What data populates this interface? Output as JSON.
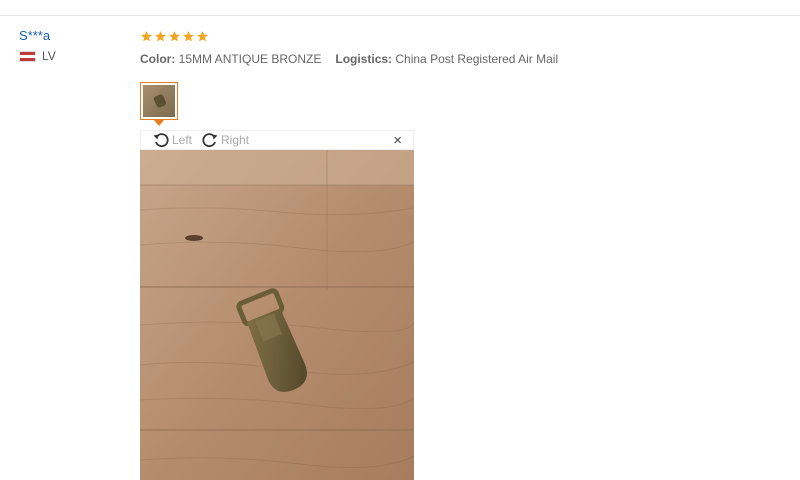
{
  "reviewer": {
    "name": "S***a",
    "country": "LV"
  },
  "review": {
    "rating": 5,
    "rating_max": 5,
    "star_color": "#f5a623",
    "attributes": [
      {
        "key": "Color:",
        "value": "15MM ANTIQUE BRONZE"
      },
      {
        "key": "Logistics:",
        "value": "China Post Registered Air Mail"
      }
    ]
  },
  "viewer": {
    "rotate_left_label": "Left",
    "rotate_right_label": "Right",
    "close_symbol": "×",
    "accent_color": "#e87d1e",
    "icons": {
      "rotate_left": "rotate-left-icon",
      "rotate_right": "rotate-right-icon",
      "close": "close-icon"
    }
  }
}
